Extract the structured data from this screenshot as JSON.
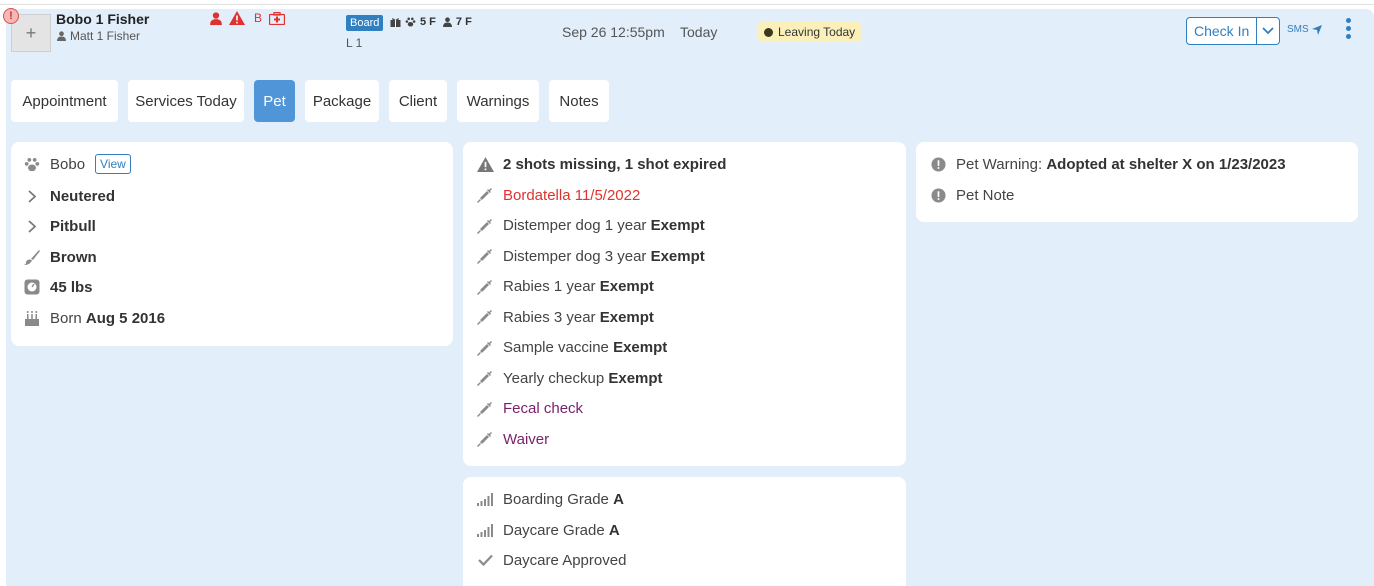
{
  "header": {
    "alert_glyph": "!",
    "add_glyph": "+",
    "pet_name": "Bobo 1 Fisher",
    "owner": "Matt 1 Fisher",
    "flag_letter": "B",
    "service_badge": "Board",
    "pets_count": "5 F",
    "people_count": "7 F",
    "location": "L 1",
    "datetime": "Sep 26 12:55pm",
    "day": "Today",
    "status": "Leaving Today",
    "checkin_label": "Check In",
    "sms_label": "SMS"
  },
  "tabs": [
    "Appointment",
    "Services Today",
    "Pet",
    "Package",
    "Client",
    "Warnings",
    "Notes"
  ],
  "active_tab": "Pet",
  "pet_card": {
    "name": "Bobo",
    "view_label": "View",
    "neutered": "Neutered",
    "breed": "Pitbull",
    "color": "Brown",
    "weight": "45 lbs",
    "born_label": "Born",
    "born_date": "Aug 5 2016"
  },
  "shots_card": {
    "summary": "2 shots missing, 1 shot expired",
    "items": [
      {
        "name": "Bordatella",
        "value": "11/5/2022",
        "style": "expired"
      },
      {
        "name": "Distemper dog 1 year",
        "value": "Exempt",
        "style": "normal"
      },
      {
        "name": "Distemper dog 3 year",
        "value": "Exempt",
        "style": "normal"
      },
      {
        "name": "Rabies 1 year",
        "value": "Exempt",
        "style": "normal"
      },
      {
        "name": "Rabies 3 year",
        "value": "Exempt",
        "style": "normal"
      },
      {
        "name": "Sample vaccine",
        "value": "Exempt",
        "style": "normal"
      },
      {
        "name": "Yearly checkup",
        "value": "Exempt",
        "style": "normal"
      },
      {
        "name": "Fecal check",
        "value": "",
        "style": "missing"
      },
      {
        "name": "Waiver",
        "value": "",
        "style": "missing"
      }
    ]
  },
  "grades_card": {
    "boarding_label": "Boarding Grade",
    "boarding_value": "A",
    "daycare_label": "Daycare Grade",
    "daycare_value": "A",
    "approved": "Daycare Approved"
  },
  "warnings_card": {
    "warning_label": "Pet Warning:",
    "warning_text": "Adopted at shelter X on 1/23/2023",
    "note_label": "Pet Note"
  },
  "colors": {
    "accent": "#2f7fc1",
    "active_tab": "#4f95d8",
    "panel_bg": "#e2eef9",
    "expired": "#e0322e",
    "missing": "#7a1f6a",
    "leaving_bg": "#fbf0b9"
  }
}
